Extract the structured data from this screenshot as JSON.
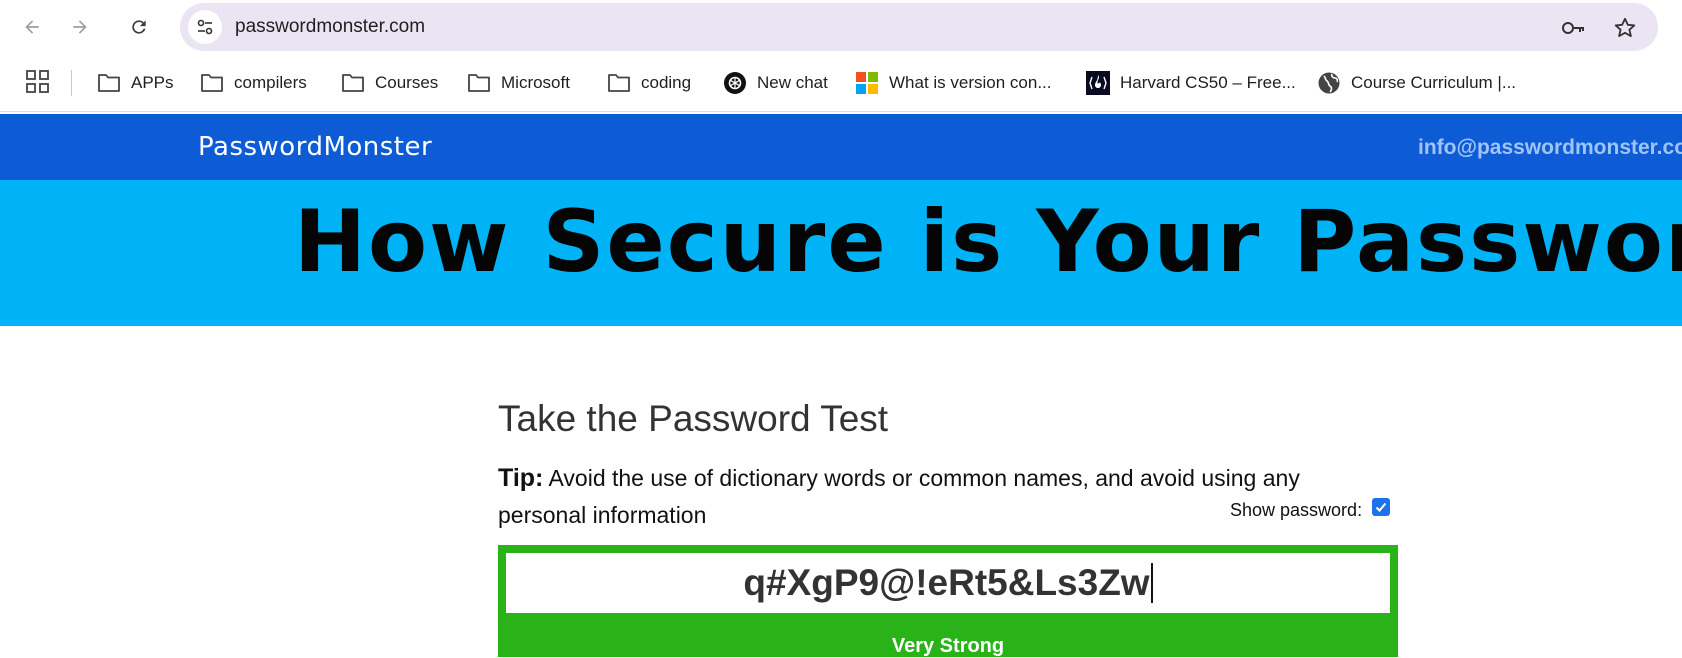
{
  "browser": {
    "url": "passwordmonster.com",
    "bookmarks": [
      {
        "label": "APPs",
        "icon": "folder-icon"
      },
      {
        "label": "compilers",
        "icon": "folder-icon"
      },
      {
        "label": "Courses",
        "icon": "folder-icon"
      },
      {
        "label": "Microsoft",
        "icon": "folder-icon"
      },
      {
        "label": "coding",
        "icon": "folder-icon"
      },
      {
        "label": "New chat",
        "icon": "openai-icon"
      },
      {
        "label": "What is version con...",
        "icon": "microsoft-icon"
      },
      {
        "label": "Harvard CS50 – Free...",
        "icon": "freecodecamp-icon"
      },
      {
        "label": "Course Curriculum |...",
        "icon": "globe-icon"
      }
    ]
  },
  "site": {
    "logo": "PasswordMonster",
    "email": "info@passwordmonster.com",
    "hero_title": "How Secure is Your Password?"
  },
  "test": {
    "heading": "Take the Password Test",
    "tip_label": "Tip:",
    "tip_text": " Avoid the use of dictionary words or common names, and avoid using any personal information",
    "show_password_label": "Show password:",
    "show_password_checked": true,
    "password_value": "q#XgP9@!eRt5&Ls3Zw",
    "strength_label": "Very Strong"
  },
  "colors": {
    "header_blue": "#0e5bd6",
    "hero_cyan": "#00b3f7",
    "strength_green": "#2ab319"
  }
}
